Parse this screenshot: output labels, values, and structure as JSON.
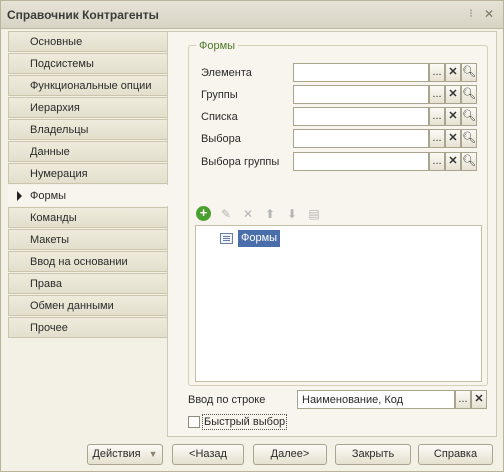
{
  "window": {
    "title": "Справочник Контрагенты",
    "pin_icon": "pin-icon",
    "close_icon": "close-icon"
  },
  "sidebar": {
    "items": [
      {
        "label": "Основные"
      },
      {
        "label": "Подсистемы"
      },
      {
        "label": "Функциональные опции"
      },
      {
        "label": "Иерархия"
      },
      {
        "label": "Владельцы"
      },
      {
        "label": "Данные"
      },
      {
        "label": "Нумерация"
      },
      {
        "label": "Формы",
        "active": true
      },
      {
        "label": "Команды"
      },
      {
        "label": "Макеты"
      },
      {
        "label": "Ввод на основании"
      },
      {
        "label": "Права"
      },
      {
        "label": "Обмен данными"
      },
      {
        "label": "Прочее"
      }
    ]
  },
  "forms_group": {
    "title": "Формы",
    "fields": [
      {
        "label": "Элемента",
        "value": ""
      },
      {
        "label": "Группы",
        "value": ""
      },
      {
        "label": "Списка",
        "value": ""
      },
      {
        "label": "Выбора",
        "value": ""
      },
      {
        "label": "Выбора группы",
        "value": ""
      }
    ],
    "field_buttons": {
      "select_label": "...",
      "clear_label": "✕",
      "open_icon": "magnifier-icon"
    },
    "toolbar_icons": [
      "add-icon",
      "edit-icon",
      "delete-icon",
      "move-up-icon",
      "move-down-icon",
      "properties-icon"
    ],
    "tree": {
      "items": [
        {
          "label": "Формы",
          "icon": "form-list-icon",
          "selected": true
        }
      ]
    }
  },
  "input_by_string": {
    "label": "Ввод по строке",
    "value": "Наименование, Код",
    "button_label": "..."
  },
  "quick_choice": {
    "label": "Быстрый выбор",
    "checked": false
  },
  "footer": {
    "actions_label": "Действия",
    "back_label": "<Назад",
    "next_label": "Далее>",
    "close_label": "Закрыть",
    "help_label": "Справка"
  },
  "colors": {
    "accent_green": "#4b9f2e",
    "selection_blue": "#4a6ea9",
    "group_title_green": "#4d7a2a"
  }
}
